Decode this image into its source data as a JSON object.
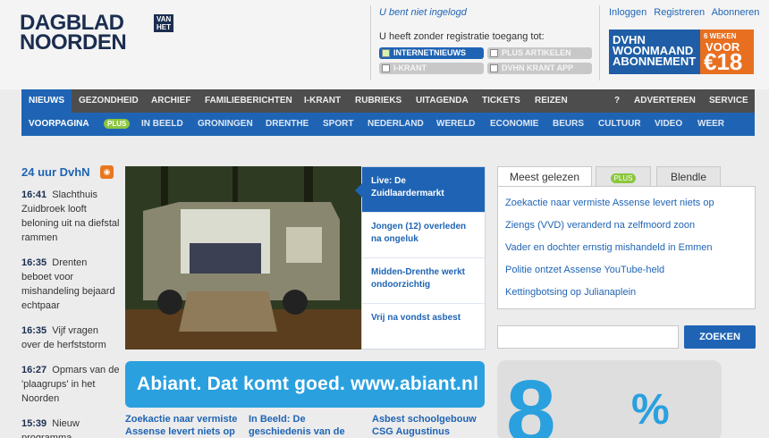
{
  "header": {
    "logo_line1": "DAGBLAD",
    "logo_line2": "NOORDEN",
    "logo_vanhet_1": "VAN",
    "logo_vanhet_2": "HET",
    "login_state": "U bent niet ingelogd",
    "registration_text": "U heeft zonder registratie toegang tot:",
    "access": [
      {
        "label": "INTERNETNIEUWS",
        "active": true
      },
      {
        "label": "PLUS ARTIKELEN",
        "active": false
      },
      {
        "label": "I-KRANT",
        "active": false
      },
      {
        "label": "DVHN KRANT APP",
        "active": false
      }
    ],
    "top_links": [
      "Inloggen",
      "Registreren",
      "Abonneren"
    ],
    "promo": {
      "line1": "DVHN",
      "line2": "WOONMAAND",
      "line3": "ABONNEMENT",
      "badge_weeks": "6 WEKEN",
      "badge_voor": "VOOR",
      "badge_price": "€18"
    }
  },
  "nav_main": [
    "NIEUWS",
    "GEZONDHEID",
    "ARCHIEF",
    "FAMILIEBERICHTEN",
    "I-KRANT",
    "RUBRIEKS",
    "UITAGENDA",
    "TICKETS",
    "REIZEN",
    "?",
    "ADVERTEREN",
    "SERVICE"
  ],
  "nav_sub": [
    "VOORPAGINA",
    "PLUS",
    "IN BEELD",
    "GRONINGEN",
    "DRENTHE",
    "SPORT",
    "NEDERLAND",
    "WERELD",
    "ECONOMIE",
    "BEURS",
    "CULTUUR",
    "VIDEO",
    "WEER"
  ],
  "latest": {
    "heading": "24 uur DvhN",
    "items": [
      {
        "time": "16:41",
        "text": "Slachthuis Zuidbroek looft beloning uit na diefstal rammen"
      },
      {
        "time": "16:35",
        "text": "Drenten beboet voor mishandeling bejaard echtpaar"
      },
      {
        "time": "16:35",
        "text": "Vijf vragen over de herfststorm"
      },
      {
        "time": "16:27",
        "text": "Opmars van de 'plaagrups' in het Noorden"
      },
      {
        "time": "15:39",
        "text": "Nieuw programma"
      }
    ]
  },
  "hero_headlines": [
    "Live: De Zuidlaardermarkt",
    "Jongen (12) overleden na ongeluk",
    "Midden-Drenthe werkt ondoorzichtig",
    "Vrij na vondst asbest"
  ],
  "banner": "Abiant. Dat komt goed. www.abiant.nl",
  "teasers": [
    {
      "l1": "Zoekactie naar vermiste",
      "l2": "Assense levert niets op"
    },
    {
      "l1": "In Beeld: De",
      "l2": "geschiedenis van de"
    },
    {
      "l1": "Asbest schoolgebouw",
      "l2": "CSG Augustinus"
    }
  ],
  "sidebar": {
    "tabs": [
      "Meest gelezen",
      "PLUS",
      "Blendle"
    ],
    "popular": [
      "Zoekactie naar vermiste Assense levert niets op",
      "Ziengs (VVD) veranderd na zelfmoord zoon",
      "Vader en dochter ernstig mishandeld in Emmen",
      "Politie ontzet Assense YouTube-held",
      "Kettingbotsing op Julianaplein"
    ],
    "search_button": "ZOEKEN",
    "stat_number": "8",
    "stat_suffix": "%"
  }
}
